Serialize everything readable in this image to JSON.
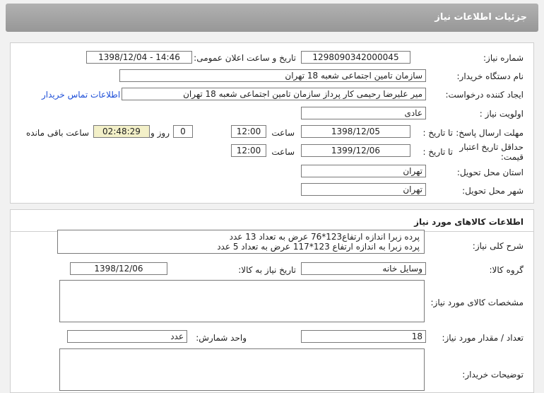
{
  "header": {
    "title": "جزئیات اطلاعات نیاز"
  },
  "need_info": {
    "need_number_label": "شماره نیاز:",
    "need_number": "1298090342000045",
    "announce_label": "تاریخ و ساعت اعلان عمومی:",
    "announce_value": "1398/12/04 - 14:46",
    "buyer_org_label": "نام دستگاه خریدار:",
    "buyer_org": "سازمان تامین اجتماعی شعبه 18 تهران",
    "requester_label": "ایجاد کننده درخواست:",
    "requester": "میر علیرضا رحیمی کار پرداز سازمان تامین اجتماعی شعبه 18 تهران",
    "contact_link": "اطلاعات تماس خریدار",
    "priority_label": "اولویت نیاز :",
    "priority": "عادی",
    "deadline_label": "مهلت ارسال پاسخ:",
    "until_date_label": "تا تاریخ :",
    "deadline_date": "1398/12/05",
    "time_label": "ساعت",
    "deadline_time": "12:00",
    "days_value": "0",
    "days_label": "روز و",
    "remaining_time": "02:48:29",
    "remaining_label": "ساعت باقی مانده",
    "validity_label": "حداقل تاریخ اعتبار قیمت:",
    "validity_date": "1399/12/06",
    "validity_time": "12:00",
    "province_label": "استان محل تحویل:",
    "province": "تهران",
    "city_label": "شهر محل تحویل:",
    "city": "تهران"
  },
  "goods": {
    "title": "اطلاعات کالاهای مورد نیاز",
    "desc_label": "شرح کلی نیاز:",
    "desc_lines": [
      "پرده زبرا اندازه ارتفاع123*76 عرض به تعداد 13 عدد",
      "پرده زبرا به اندازه ارتفاع 123*117 عرض به تعداد 5 عدد"
    ],
    "group_label": "گروه کالا:",
    "group": "وسایل خانه",
    "need_date_label": "تاریخ نیاز به کالا:",
    "need_date": "1398/12/06",
    "specs_label": "مشخصات کالای مورد نیاز:",
    "qty_label": "تعداد / مقدار مورد نیاز:",
    "qty": "18",
    "unit_label": "واحد شمارش:",
    "unit": "عدد",
    "buyer_notes_label": "توضیحات خریدار:"
  }
}
